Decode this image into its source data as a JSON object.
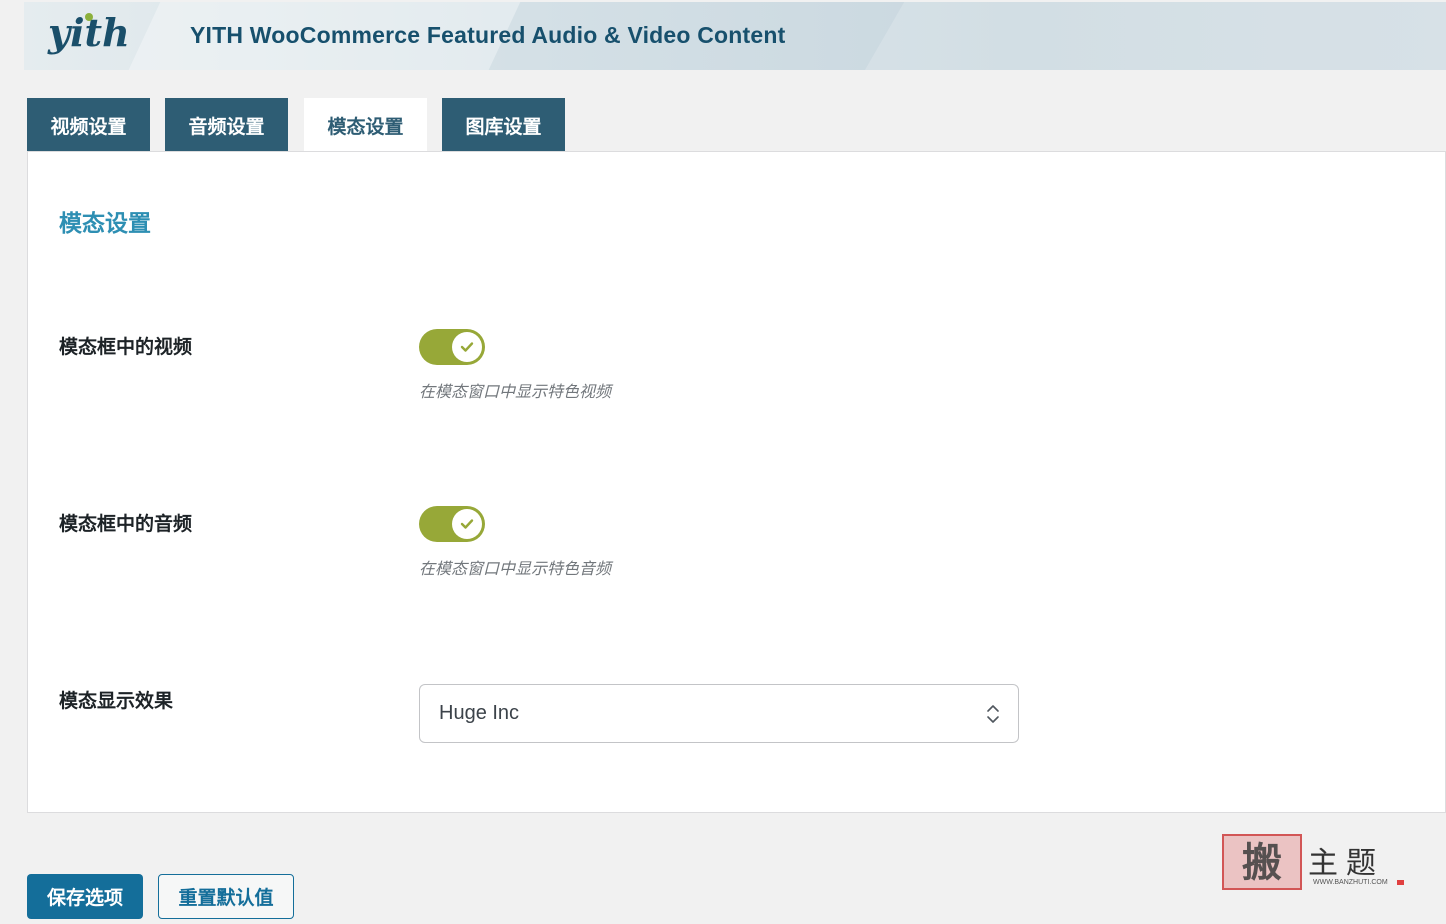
{
  "header": {
    "logo_text": "yith",
    "title": "YITH WooCommerce Featured Audio & Video Content"
  },
  "tabs": [
    {
      "label": "视频设置",
      "active": false
    },
    {
      "label": "音频设置",
      "active": false
    },
    {
      "label": "模态设置",
      "active": true
    },
    {
      "label": "图库设置",
      "active": false
    }
  ],
  "section": {
    "title": "模态设置",
    "rows": [
      {
        "label": "模态框中的视频",
        "control": "toggle",
        "enabled": true,
        "description": "在模态窗口中显示特色视频"
      },
      {
        "label": "模态框中的音频",
        "control": "toggle",
        "enabled": true,
        "description": "在模态窗口中显示特色音频"
      },
      {
        "label": "模态显示效果",
        "control": "select",
        "value": "Huge Inc"
      }
    ]
  },
  "buttons": {
    "save": "保存选项",
    "reset": "重置默认值"
  },
  "watermark": {
    "stamp": "搬",
    "text": "主题",
    "url": "WWW.BANZHUTI.COM"
  },
  "colors": {
    "tab_bg": "#2e5d74",
    "accent_title": "#2e8fb3",
    "toggle_on": "#97a838",
    "primary_button": "#146e9a"
  }
}
